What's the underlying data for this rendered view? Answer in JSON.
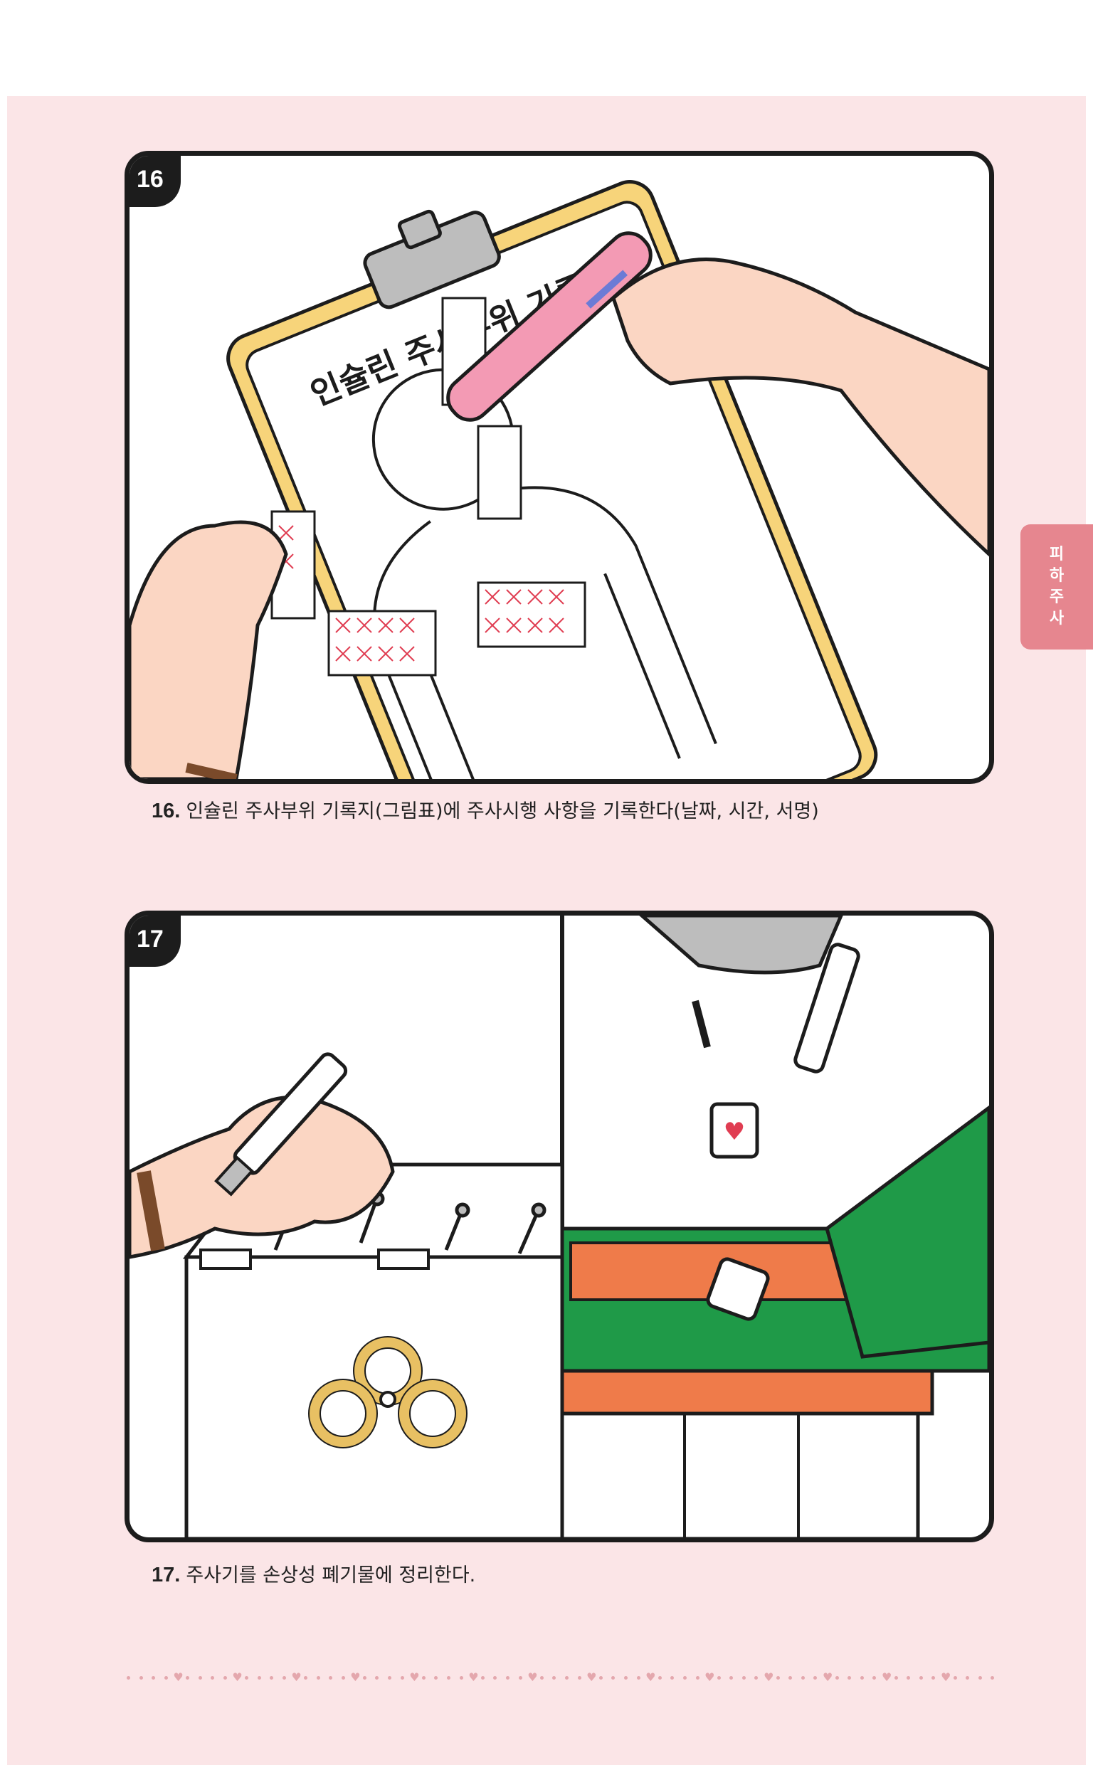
{
  "side_tab": {
    "label": [
      "피",
      "하",
      "주",
      "사"
    ]
  },
  "steps": [
    {
      "number": "16",
      "caption_number": "16.",
      "caption_text": "인슐린 주사부위 기록지(그림표)에 주사시행 사항을 기록한다(날짜, 시간, 서명)",
      "clipboard_title": "인슐린 주사부위 기록지"
    },
    {
      "number": "17",
      "caption_number": "17.",
      "caption_text": "주사기를 손상성 폐기물에 정리한다."
    }
  ],
  "colors": {
    "page_background": "#fbe5e7",
    "side_tab": "#e6868f",
    "outline": "#1c1c1c",
    "clipboard": "#f7d47a",
    "skin": "#fbd6c3",
    "pen": "#f39ab4",
    "grid_mark": "#e03d52",
    "bin_green": "#1f9a48",
    "bin_orange": "#ef7b4a",
    "biohazard": "#e8c063"
  }
}
